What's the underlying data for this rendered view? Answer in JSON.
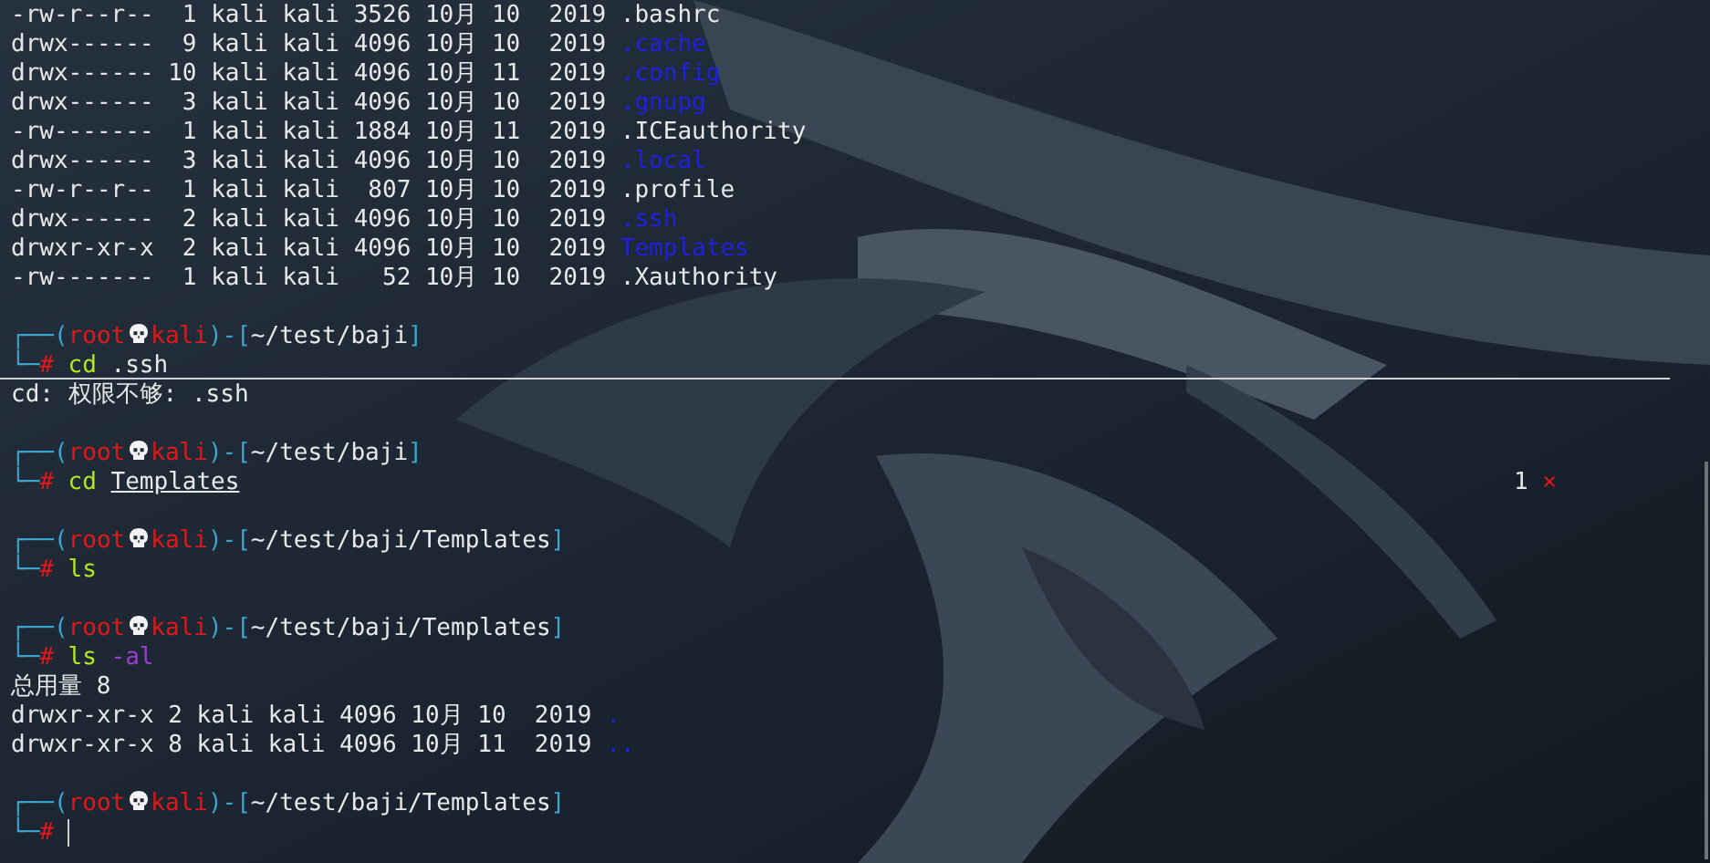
{
  "lines": [
    {
      "kind": "entry",
      "info": "-rw-r--r--  1 kali kali 3526 10月 10  2019 ",
      "name": ".bashrc",
      "is_dir": false
    },
    {
      "kind": "entry",
      "info": "drwx------  9 kali kali 4096 10月 10  2019 ",
      "name": ".cache",
      "is_dir": true
    },
    {
      "kind": "entry",
      "info": "drwx------ 10 kali kali 4096 10月 11  2019 ",
      "name": ".config",
      "is_dir": true
    },
    {
      "kind": "entry",
      "info": "drwx------  3 kali kali 4096 10月 10  2019 ",
      "name": ".gnupg",
      "is_dir": true
    },
    {
      "kind": "entry",
      "info": "-rw-------  1 kali kali 1884 10月 11  2019 ",
      "name": ".ICEauthority",
      "is_dir": false
    },
    {
      "kind": "entry",
      "info": "drwx------  3 kali kali 4096 10月 10  2019 ",
      "name": ".local",
      "is_dir": true
    },
    {
      "kind": "entry",
      "info": "-rw-r--r--  1 kali kali  807 10月 10  2019 ",
      "name": ".profile",
      "is_dir": false
    },
    {
      "kind": "entry",
      "info": "drwx------  2 kali kali 4096 10月 10  2019 ",
      "name": ".ssh",
      "is_dir": true
    },
    {
      "kind": "entry",
      "info": "drwxr-xr-x  2 kali kali 4096 10月 10  2019 ",
      "name": "Templates",
      "is_dir": true
    },
    {
      "kind": "entry",
      "info": "-rw-------  1 kali kali   52 10月 10  2019 ",
      "name": ".Xauthority",
      "is_dir": false
    },
    {
      "kind": "blank"
    },
    {
      "kind": "prompt",
      "open": "┌──(",
      "user": "root",
      "host": "kali",
      "mid": ")-[",
      "path": "~/test/baji",
      "close": "]"
    },
    {
      "kind": "command",
      "corner": "└─",
      "sigil": "#",
      "command": "cd",
      "args": ".ssh",
      "arg_underlined": false,
      "arg_is_option": false,
      "separator": true
    },
    {
      "kind": "output",
      "text": "cd: 权限不够: .ssh"
    },
    {
      "kind": "blank"
    },
    {
      "kind": "prompt",
      "open": "┌──(",
      "user": "root",
      "host": "kali",
      "mid": ")-[",
      "path": "~/test/baji",
      "close": "]"
    },
    {
      "kind": "command",
      "corner": "└─",
      "sigil": "#",
      "command": "cd",
      "args": "Templates",
      "arg_underlined": true,
      "arg_is_option": false,
      "status": "1",
      "status_icon": "×"
    },
    {
      "kind": "blank"
    },
    {
      "kind": "prompt",
      "open": "┌──(",
      "user": "root",
      "host": "kali",
      "mid": ")-[",
      "path": "~/test/baji/Templates",
      "close": "]"
    },
    {
      "kind": "command",
      "corner": "└─",
      "sigil": "#",
      "command": "ls"
    },
    {
      "kind": "blank"
    },
    {
      "kind": "prompt",
      "open": "┌──(",
      "user": "root",
      "host": "kali",
      "mid": ")-[",
      "path": "~/test/baji/Templates",
      "close": "]"
    },
    {
      "kind": "command",
      "corner": "└─",
      "sigil": "#",
      "command": "ls",
      "args": "-al",
      "arg_underlined": false,
      "arg_is_option": true
    },
    {
      "kind": "output",
      "text": "总用量 8"
    },
    {
      "kind": "entry",
      "info": "drwxr-xr-x 2 kali kali 4096 10月 10  2019 ",
      "name": ".",
      "is_dir": true
    },
    {
      "kind": "entry",
      "info": "drwxr-xr-x 8 kali kali 4096 10月 11  2019 ",
      "name": "..",
      "is_dir": true
    },
    {
      "kind": "blank"
    },
    {
      "kind": "prompt",
      "open": "┌──(",
      "user": "root",
      "host": "kali",
      "mid": ")-[",
      "path": "~/test/baji/Templates",
      "close": "]"
    },
    {
      "kind": "command",
      "corner": "└─",
      "sigil": "#",
      "cursor": true
    }
  ]
}
